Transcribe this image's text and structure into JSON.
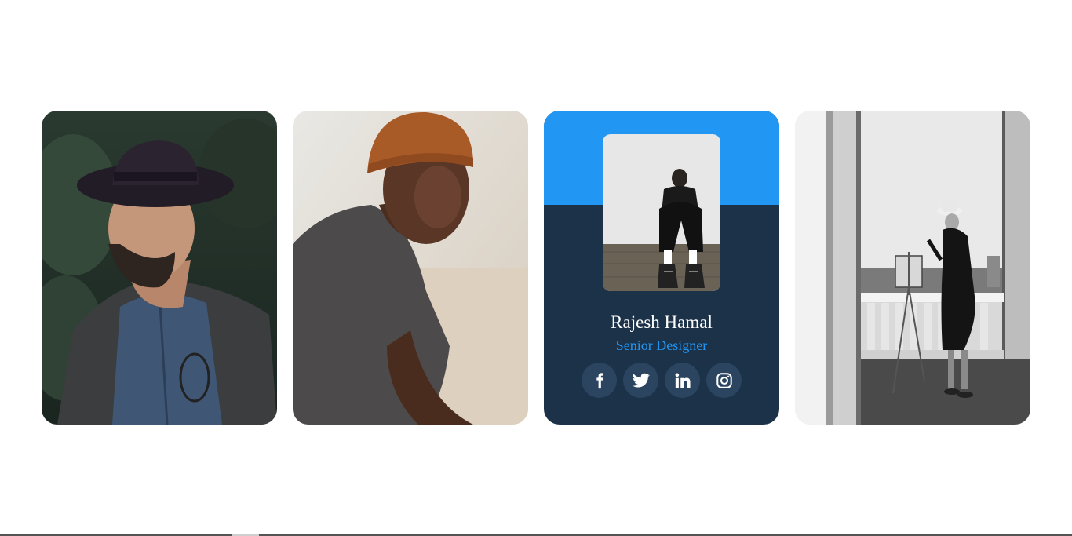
{
  "profile": {
    "name": "Rajesh Hamal",
    "title": "Senior Designer"
  },
  "cards": [
    {
      "photo": "man-in-black-hat-photo"
    },
    {
      "photo": "man-in-orange-beanie-photo"
    },
    {
      "photo": "man-sitting-against-wall-photo"
    },
    {
      "photo": "painter-at-easel-photo"
    }
  ],
  "socials": [
    {
      "icon": "facebook-icon"
    },
    {
      "icon": "twitter-icon"
    },
    {
      "icon": "linkedin-icon"
    },
    {
      "icon": "instagram-icon"
    }
  ],
  "colors": {
    "accent": "#2196f3",
    "card_dark": "#1c3249",
    "social_bg": "#2b4460"
  }
}
